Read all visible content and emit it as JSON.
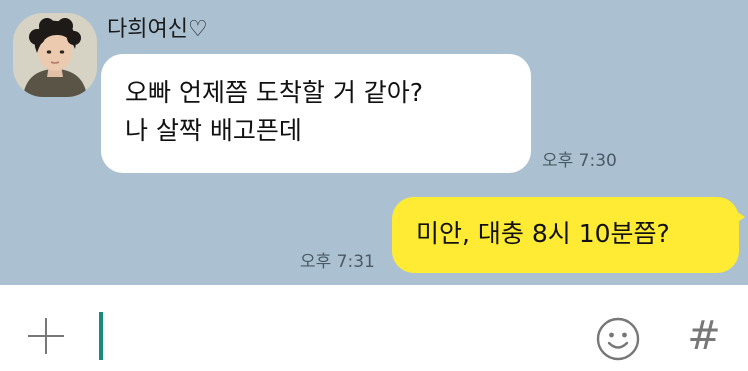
{
  "chat": {
    "sender_name": "다희여신♡",
    "messages": [
      {
        "direction": "incoming",
        "lines": [
          "오빠 언제쯤 도착할 거 같아?",
          "나 살짝 배고픈데"
        ],
        "time": "오후 7:30"
      },
      {
        "direction": "outgoing",
        "lines": [
          "미안, 대충 8시 10분쯤?"
        ],
        "time": "오후 7:31"
      }
    ]
  },
  "input": {
    "value": "",
    "placeholder": ""
  },
  "icons": {
    "attach": "plus-icon",
    "emoticon": "smiley-icon",
    "hashtag": "hash-icon"
  },
  "colors": {
    "chat_background": "#abc1d1",
    "incoming_bubble": "#ffffff",
    "outgoing_bubble": "#ffeb33",
    "caret": "#1c8a7a"
  }
}
